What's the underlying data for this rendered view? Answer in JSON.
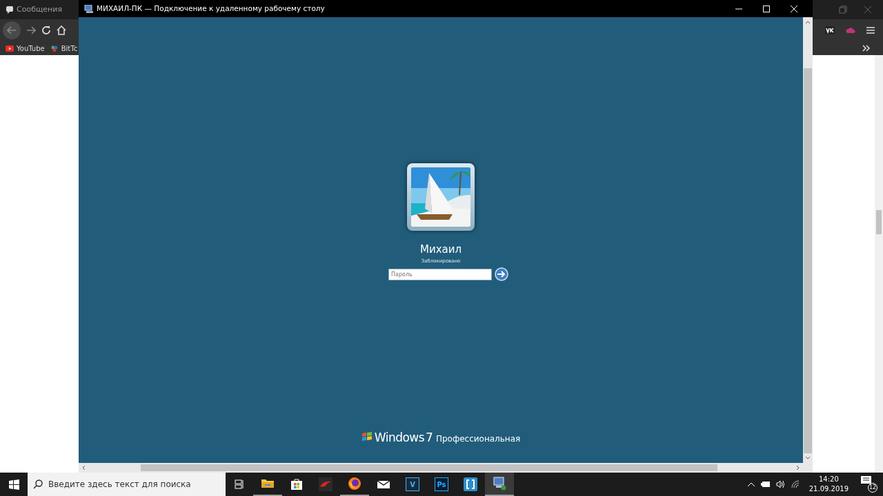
{
  "browser": {
    "tab_title": "Сообщения",
    "bookmarks": [
      {
        "label": "YouTube",
        "kind": "youtube"
      },
      {
        "label": "BitTc",
        "kind": "bittorrent"
      }
    ]
  },
  "rdp_window": {
    "title": "МИХАИЛ-ПК — Подключение к удаленному рабочему столу",
    "user": {
      "name": "Михаил",
      "status": "Заблокировано"
    },
    "password": {
      "placeholder": "Пароль"
    },
    "branding": {
      "product": "Windows",
      "version": "7",
      "edition": "Профессиональная"
    }
  },
  "taskbar": {
    "search": {
      "placeholder": "Введите здесь текст для поиска"
    },
    "apps": [
      {
        "kind": "explorer",
        "active": true
      },
      {
        "kind": "store",
        "active": false
      },
      {
        "kind": "game",
        "active": false
      },
      {
        "kind": "firefox",
        "active": true
      },
      {
        "kind": "mail",
        "active": false
      },
      {
        "kind": "vegas",
        "label": "V",
        "active": false
      },
      {
        "kind": "photoshop",
        "label": "Ps",
        "active": false
      },
      {
        "kind": "brackets",
        "active": false
      },
      {
        "kind": "remote",
        "active": true
      }
    ],
    "clock": {
      "time": "14:20",
      "date": "21.09.2019"
    },
    "notifications": {
      "count": "12"
    }
  }
}
